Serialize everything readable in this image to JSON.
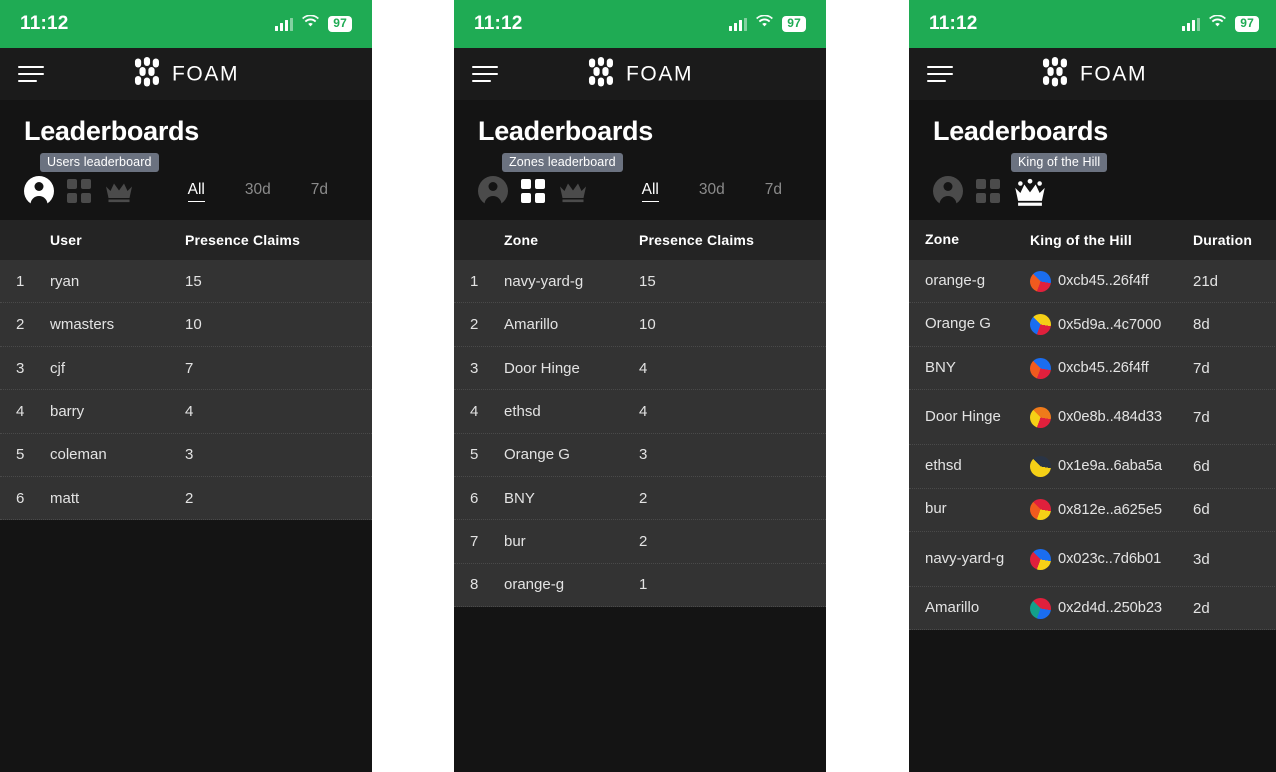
{
  "statusbar": {
    "time": "11:12",
    "battery": "97",
    "signal_icon": "signal-bars-icon",
    "wifi_icon": "wifi-icon"
  },
  "navbar": {
    "menu_icon": "hamburger-menu-icon",
    "brand": "FOAM",
    "logo_icon": "foam-logo-icon"
  },
  "colors": {
    "accent_green": "#1fab54",
    "panel_bg": "#141414",
    "row_bg": "#333333",
    "header_row_bg": "#242424",
    "badge_bg": "#6b7280"
  },
  "time_filters": [
    {
      "label": "All",
      "active": true
    },
    {
      "label": "30d",
      "active": false
    },
    {
      "label": "7d",
      "active": false
    }
  ],
  "panels": [
    {
      "title": "Leaderboards",
      "badge": "Users leaderboard",
      "icons": [
        {
          "name": "user-leaderboard-icon",
          "active": true
        },
        {
          "name": "zones-leaderboard-icon",
          "active": false
        },
        {
          "name": "king-of-the-hill-icon",
          "active": false
        }
      ],
      "columns": [
        "",
        "User",
        "Presence Claims"
      ],
      "rows": [
        {
          "rank": "1",
          "name": "ryan",
          "value": "15"
        },
        {
          "rank": "2",
          "name": "wmasters",
          "value": "10"
        },
        {
          "rank": "3",
          "name": "cjf",
          "value": "7"
        },
        {
          "rank": "4",
          "name": "barry",
          "value": "4"
        },
        {
          "rank": "5",
          "name": "coleman",
          "value": "3"
        },
        {
          "rank": "6",
          "name": "matt",
          "value": "2"
        }
      ]
    },
    {
      "title": "Leaderboards",
      "badge": "Zones leaderboard",
      "icons": [
        {
          "name": "user-leaderboard-icon",
          "active": false
        },
        {
          "name": "zones-leaderboard-icon",
          "active": true
        },
        {
          "name": "king-of-the-hill-icon",
          "active": false
        }
      ],
      "columns": [
        "",
        "Zone",
        "Presence Claims"
      ],
      "rows": [
        {
          "rank": "1",
          "name": "navy-yard-g",
          "value": "15"
        },
        {
          "rank": "2",
          "name": "Amarillo",
          "value": "10"
        },
        {
          "rank": "3",
          "name": "Door Hinge",
          "value": "4"
        },
        {
          "rank": "4",
          "name": "ethsd",
          "value": "4"
        },
        {
          "rank": "5",
          "name": "Orange G",
          "value": "3"
        },
        {
          "rank": "6",
          "name": "BNY",
          "value": "2"
        },
        {
          "rank": "7",
          "name": "bur",
          "value": "2"
        },
        {
          "rank": "8",
          "name": "orange-g",
          "value": "1"
        }
      ]
    },
    {
      "title": "Leaderboards",
      "badge": "King of the Hill",
      "icons": [
        {
          "name": "user-leaderboard-icon",
          "active": false
        },
        {
          "name": "zones-leaderboard-icon",
          "active": false
        },
        {
          "name": "king-of-the-hill-icon",
          "active": true
        }
      ],
      "columns": [
        "Zone",
        "King of the Hill",
        "Duration"
      ],
      "rows": [
        {
          "zone": "orange-g",
          "address": "0xcb45..26f4ff",
          "duration": "21d",
          "identicon": [
            "#f05a1e",
            "#1a6df0",
            "#e0203c"
          ]
        },
        {
          "zone": "Orange G",
          "address": "0x5d9a..4c7000",
          "duration": "8d",
          "identicon": [
            "#1a6df0",
            "#f5d016",
            "#e0203c"
          ]
        },
        {
          "zone": "BNY",
          "address": "0xcb45..26f4ff",
          "duration": "7d",
          "identicon": [
            "#f05a1e",
            "#1a6df0",
            "#e0203c"
          ]
        },
        {
          "zone": "Door Hinge",
          "address": "0x0e8b..484d33",
          "duration": "7d",
          "identicon": [
            "#f5d016",
            "#ef7a1a",
            "#e0203c"
          ]
        },
        {
          "zone": "ethsd",
          "address": "0x1e9a..6aba5a",
          "duration": "6d",
          "identicon": [
            "#f5d016",
            "#2a3445",
            "#f5d016"
          ]
        },
        {
          "zone": "bur",
          "address": "0x812e..a625e5",
          "duration": "6d",
          "identicon": [
            "#f05a1e",
            "#e0203c",
            "#f5d016"
          ]
        },
        {
          "zone": "navy-yard-g",
          "address": "0x023c..7d6b01",
          "duration": "3d",
          "identicon": [
            "#e0203c",
            "#1a6df0",
            "#f5d016"
          ]
        },
        {
          "zone": "Amarillo",
          "address": "0x2d4d..250b23",
          "duration": "2d",
          "identicon": [
            "#13a08a",
            "#e0203c",
            "#1a6df0"
          ]
        }
      ]
    }
  ]
}
